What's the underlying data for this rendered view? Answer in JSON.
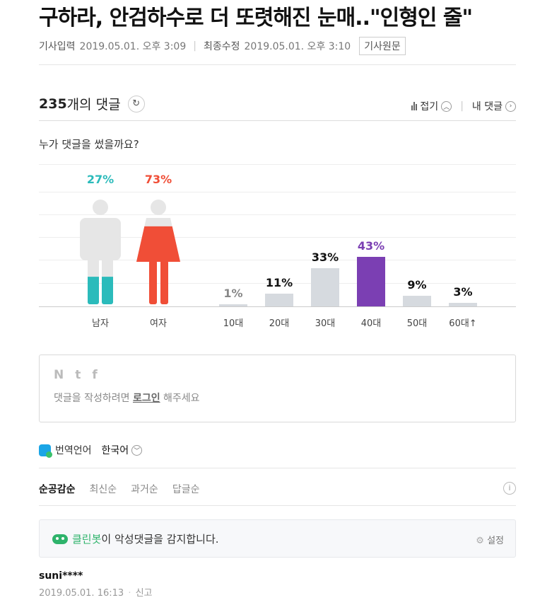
{
  "article": {
    "title": "구하라, 안검하수로 더 또렷해진 눈매..\"인형인 줄\"",
    "input_label": "기사입력",
    "input_time": "2019.05.01. 오후 3:09",
    "modified_label": "최종수정",
    "modified_time": "2019.05.01. 오후 3:10",
    "source_button": "기사원문"
  },
  "comments": {
    "count": "235",
    "count_suffix": "개의 댓글",
    "fold_label": "접기",
    "my_comments_label": "내 댓글",
    "who_wrote": "누가 댓글을 썼을까요?"
  },
  "gender": {
    "male_pct": "27%",
    "female_pct": "73%",
    "male_label": "남자",
    "female_label": "여자",
    "male_value": 0.27,
    "female_value": 0.73,
    "male_color": "#2bbbbb",
    "female_color": "#f04e37"
  },
  "chart_data": {
    "type": "bar",
    "categories": [
      "10대",
      "20대",
      "30대",
      "40대",
      "50대",
      "60대↑"
    ],
    "values": [
      1,
      11,
      33,
      43,
      9,
      3
    ],
    "labels": [
      "1%",
      "11%",
      "33%",
      "43%",
      "9%",
      "3%"
    ],
    "highlight_index": 3,
    "highlight_color": "#7b3fb3",
    "bar_color": "#d6dadf",
    "ylim": [
      0,
      43
    ]
  },
  "login": {
    "sns": [
      "N",
      "t",
      "f"
    ],
    "prefix": "댓글을 작성하려면 ",
    "link": "로그인",
    "suffix": " 해주세요"
  },
  "translation": {
    "label": "번역언어",
    "value": "한국어"
  },
  "sort_tabs": [
    "순공감순",
    "최신순",
    "과거순",
    "답글순"
  ],
  "cleanbot": {
    "name": "클린봇",
    "message": "이 악성댓글을 감지합니다.",
    "settings": "설정"
  },
  "first_comment": {
    "user": "suni****",
    "date": "2019.05.01. 16:13",
    "report": "신고"
  }
}
